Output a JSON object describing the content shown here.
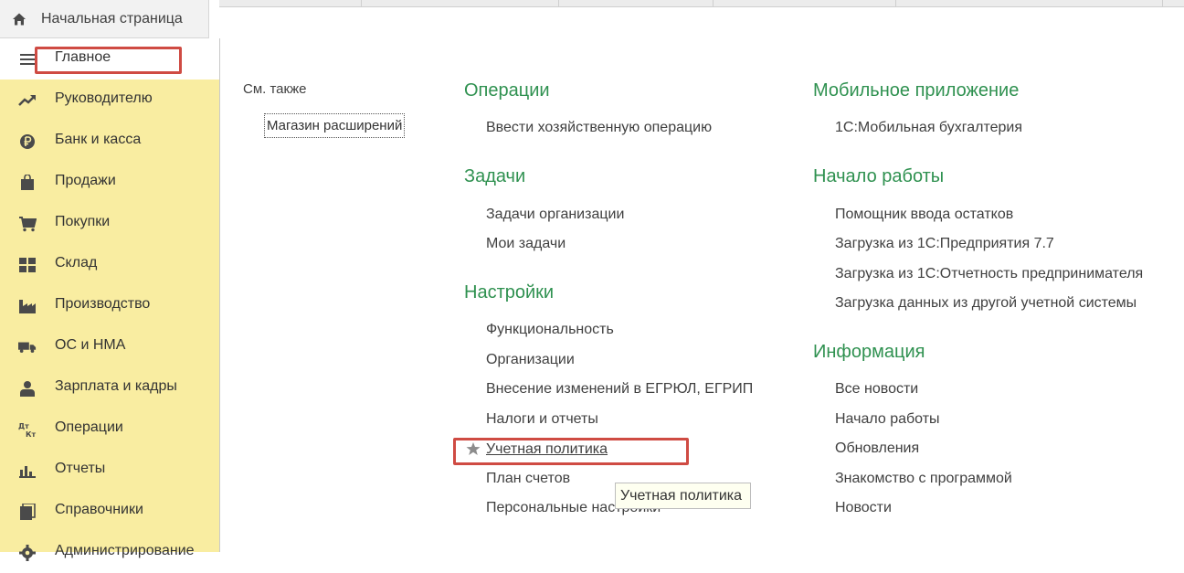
{
  "home_tab": {
    "label": "Начальная страница",
    "icon": "home-icon"
  },
  "sidebar": {
    "items": [
      {
        "label": "Главное",
        "icon": "menu-lines-icon",
        "active": true
      },
      {
        "label": "Руководителю",
        "icon": "trend-icon"
      },
      {
        "label": "Банк и касса",
        "icon": "ruble-coin-icon"
      },
      {
        "label": "Продажи",
        "icon": "shopping-bag-icon"
      },
      {
        "label": "Покупки",
        "icon": "cart-icon"
      },
      {
        "label": "Склад",
        "icon": "warehouse-grid-icon"
      },
      {
        "label": "Производство",
        "icon": "factory-icon"
      },
      {
        "label": "ОС и НМА",
        "icon": "truck-icon"
      },
      {
        "label": "Зарплата и кадры",
        "icon": "person-icon"
      },
      {
        "label": "Операции",
        "icon": "debit-credit-icon"
      },
      {
        "label": "Отчеты",
        "icon": "bar-chart-icon"
      },
      {
        "label": "Справочники",
        "icon": "books-icon"
      },
      {
        "label": "Администрирование",
        "icon": "gear-icon"
      }
    ]
  },
  "see_also": {
    "title": "См. также",
    "store_button": "Магазин расширений"
  },
  "operations": {
    "title": "Операции",
    "links": [
      "Ввести хозяйственную операцию"
    ]
  },
  "tasks": {
    "title": "Задачи",
    "links": [
      "Задачи организации",
      "Мои задачи"
    ]
  },
  "settings": {
    "title": "Настройки",
    "links": [
      "Функциональность",
      "Организации",
      "Внесение изменений в ЕГРЮЛ, ЕГРИП",
      "Налоги и отчеты",
      "Учетная политика",
      "План счетов",
      "Персональные настройки"
    ]
  },
  "mobile": {
    "title": "Мобильное приложение",
    "links": [
      "1С:Мобильная бухгалтерия"
    ]
  },
  "getting_started": {
    "title": "Начало работы",
    "links": [
      "Помощник ввода остатков",
      "Загрузка из 1С:Предприятия 7.7",
      "Загрузка из 1С:Отчетность предпринимателя",
      "Загрузка данных из другой учетной системы"
    ]
  },
  "info": {
    "title": "Информация",
    "links": [
      "Все новости",
      "Начало работы",
      "Обновления",
      "Знакомство с программой",
      "Новости"
    ]
  },
  "tooltip": {
    "text": "Учетная политика"
  },
  "colors": {
    "sidebar_bg": "#f9eda1",
    "section_title": "#2f9150",
    "highlight": "#cf4b43"
  }
}
